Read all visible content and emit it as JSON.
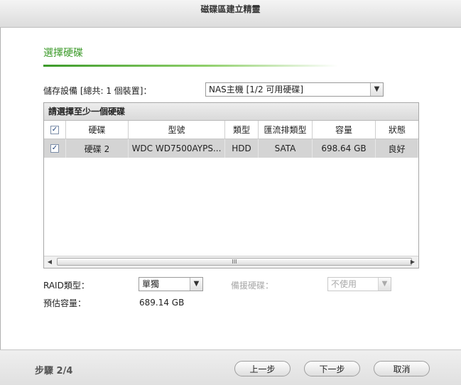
{
  "window": {
    "title": "磁碟區建立精靈"
  },
  "section": {
    "title": "選擇硬碟"
  },
  "storage": {
    "label": "儲存設備 [總共: 1 個裝置]：",
    "selected": "NAS主機 [1/2 可用硬碟]"
  },
  "grid": {
    "caption": "請選擇至少一個硬碟",
    "columns": [
      "硬碟",
      "型號",
      "類型",
      "匯流排類型",
      "容量",
      "狀態"
    ],
    "rows": [
      {
        "checked": true,
        "disk": "硬碟 2",
        "model": "WDC WD7500AYPS...",
        "type": "HDD",
        "bus": "SATA",
        "capacity": "698.64 GB",
        "status": "良好"
      }
    ],
    "scroll_mid_glyph": "III"
  },
  "raid": {
    "label": "RAID類型：",
    "selected": "單獨"
  },
  "spare": {
    "label": "備援硬碟：",
    "selected": "不使用"
  },
  "capacity": {
    "label": "預估容量：",
    "value": "689.14 GB"
  },
  "footer": {
    "step": "步驟 2/4",
    "prev": "上一步",
    "next": "下一步",
    "cancel": "取消"
  },
  "icons": {
    "checkmark": "check-icon",
    "dropdown": "chevron-down-icon"
  }
}
